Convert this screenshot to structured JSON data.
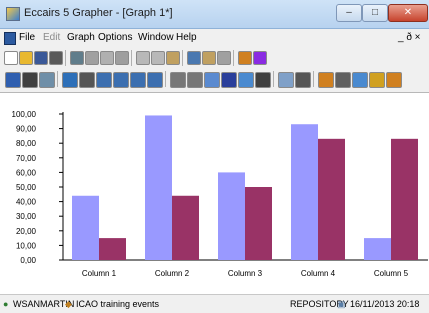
{
  "window": {
    "title": "Eccairs 5 Grapher - [Graph 1*]",
    "buttons": {
      "minimize": "–",
      "maximize": "□",
      "close": "✕"
    }
  },
  "menu": {
    "items": [
      {
        "label": "File",
        "enabled": true
      },
      {
        "label": "Edit",
        "enabled": false
      },
      {
        "label": "Graph",
        "enabled": true
      },
      {
        "label": "Options",
        "enabled": true
      },
      {
        "label": "Window",
        "enabled": true
      },
      {
        "label": "Help",
        "enabled": true
      }
    ],
    "mdi_controls": "_ ð ×"
  },
  "toolbar1": {
    "buttons": [
      {
        "icon": "new-document-icon",
        "color": "#ffffff"
      },
      {
        "icon": "open-folder-icon",
        "color": "#e8b830"
      },
      {
        "icon": "save-disk-icon",
        "color": "#3b5998"
      },
      {
        "icon": "print-icon",
        "color": "#5a5a5a"
      },
      {
        "icon": "print-preview-icon",
        "color": "#607d8b"
      },
      {
        "icon": "pen-icon",
        "color": "#a0a0a0"
      },
      {
        "icon": "delete-icon",
        "color": "#b0b0b0"
      },
      {
        "icon": "arrow-icon",
        "color": "#9e9e9e"
      },
      {
        "icon": "cut-icon",
        "color": "#b8b8b8"
      },
      {
        "icon": "copy-icon",
        "color": "#b8b8b8"
      },
      {
        "icon": "paste-icon",
        "color": "#c0a060"
      },
      {
        "icon": "chart-window-icon",
        "color": "#4a78b0"
      },
      {
        "icon": "chart-bar-icon",
        "color": "#c0a060"
      },
      {
        "icon": "chart-pie-icon",
        "color": "#a0a0a0"
      },
      {
        "icon": "database-icon",
        "color": "#d08020"
      },
      {
        "icon": "filter-icon",
        "color": "#8a2be2"
      }
    ]
  },
  "toolbar2": {
    "buttons": [
      {
        "icon": "save-icon",
        "color": "#2f5fb0"
      },
      {
        "icon": "camera-icon",
        "color": "#404040"
      },
      {
        "icon": "globe-icon",
        "color": "#6f8fa8"
      },
      {
        "icon": "bar-chart-icon",
        "color": "#2d6fb8"
      },
      {
        "icon": "fill-color-icon",
        "color": "#555555"
      },
      {
        "icon": "grid-icon",
        "color": "#3c6fb0"
      },
      {
        "icon": "table-icon",
        "color": "#3c6fb0"
      },
      {
        "icon": "columns-icon",
        "color": "#3c6fb0"
      },
      {
        "icon": "rows-icon",
        "color": "#3c6fb0"
      },
      {
        "icon": "link-icon",
        "color": "#777777"
      },
      {
        "icon": "move-icon",
        "color": "#777777"
      },
      {
        "icon": "format-icon",
        "color": "#5a8ad0"
      },
      {
        "icon": "text-icon",
        "color": "#2a3f9b"
      },
      {
        "icon": "picture-icon",
        "color": "#4a8ad0"
      },
      {
        "icon": "layout-icon",
        "color": "#404040"
      },
      {
        "icon": "zoom-icon",
        "color": "#7fa0c8"
      },
      {
        "icon": "sort-icon",
        "color": "#555555"
      },
      {
        "icon": "properties-icon",
        "color": "#d08020"
      },
      {
        "icon": "legend-icon",
        "color": "#606060"
      },
      {
        "icon": "axis-icon",
        "color": "#4a8ad0"
      },
      {
        "icon": "wizard-icon",
        "color": "#d0a020"
      },
      {
        "icon": "help-icon",
        "color": "#d08020"
      }
    ]
  },
  "chart_data": {
    "type": "bar",
    "categories": [
      "Column 1",
      "Column 2",
      "Column 3",
      "Column 4",
      "Column 5"
    ],
    "series": [
      {
        "values": [
          44,
          99,
          60,
          93,
          15
        ],
        "color": "#9999ff"
      },
      {
        "values": [
          15,
          44,
          50,
          83,
          83
        ],
        "color": "#993366"
      }
    ],
    "ylim": [
      0,
      100
    ],
    "yticks": [
      "0,00",
      "10,00",
      "20,00",
      "30,00",
      "40,00",
      "50,00",
      "60,00",
      "70,00",
      "80,00",
      "90,00",
      "100,00"
    ],
    "grid": false,
    "legend": "none"
  },
  "status": {
    "user": "WSANMARTIN",
    "event_set": "ICAO training events",
    "repository": "REPOSITORY",
    "datetime": "16/11/2013  20:18"
  }
}
